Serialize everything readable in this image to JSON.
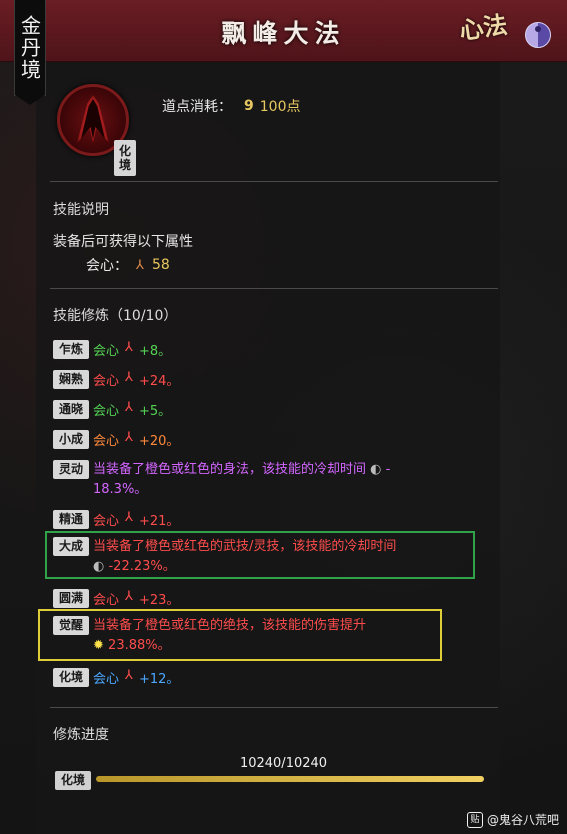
{
  "banner": {
    "title": "飘峰大法",
    "emblem": "心法"
  },
  "realm_label": "金丹境",
  "skill": {
    "realm_badge_top": "化",
    "realm_badge_bottom": "境"
  },
  "cost": {
    "label": "道点消耗：",
    "icon": "9",
    "value": "100点"
  },
  "description": {
    "title": "技能说明",
    "text": "装备后可获得以下属性",
    "stat_label": "会心：",
    "stat_icon": "⅄",
    "stat_value": "58"
  },
  "training": {
    "title": "技能修炼（10/10）",
    "rows": [
      {
        "tag": "乍炼",
        "stat": "会心",
        "icon": "⅄",
        "value": "+8。"
      },
      {
        "tag": "娴熟",
        "stat": "会心",
        "icon": "⅄",
        "value": "+24。"
      },
      {
        "tag": "通晓",
        "stat": "会心",
        "icon": "⅄",
        "value": "+5。"
      },
      {
        "tag": "小成",
        "stat": "会心",
        "icon": "⅄",
        "value": "+20。"
      },
      {
        "tag": "灵动",
        "line1": "当装备了橙色或红色的身法，该技能的冷却时间",
        "line1_end": "-",
        "line2": "18.3%。"
      },
      {
        "tag": "精通",
        "stat": "会心",
        "icon": "⅄",
        "value": "+21。"
      },
      {
        "tag": "大成",
        "line1": "当装备了橙色或红色的武技/灵技，该技能的冷却时间",
        "line2": "-22.23%。"
      },
      {
        "tag": "圆满",
        "stat": "会心",
        "icon": "⅄",
        "value": "+23。"
      },
      {
        "tag": "觉醒",
        "line1": "当装备了橙色或红色的绝技，该技能的伤害提升",
        "line2": "23.88%。"
      },
      {
        "tag": "化境",
        "stat": "会心",
        "icon": "⅄",
        "value": "+12。"
      }
    ]
  },
  "progress": {
    "title": "修炼进度",
    "value_text": "10240/10240",
    "fraction": 1.0,
    "tag": "化境"
  },
  "watermark": {
    "icon": "贴",
    "text": "@鬼谷八荒吧"
  },
  "colors": {
    "green": "#54d354",
    "red": "#ff4c4c",
    "orange": "#ff8a3c",
    "purple": "#d266ff",
    "blue": "#4aa8ff",
    "yellow": "#ffe24a",
    "banner": "#5e1a20"
  }
}
